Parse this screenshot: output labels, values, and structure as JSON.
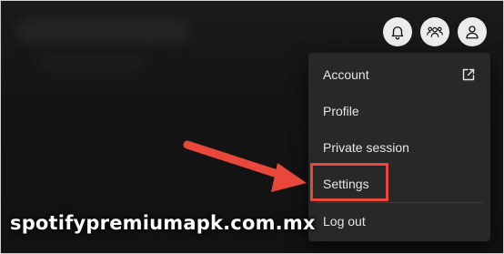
{
  "header": {
    "notifications_icon": "bell-icon",
    "friend_activity_icon": "friends-icon",
    "user_icon": "user-icon"
  },
  "menu": {
    "items": [
      {
        "label": "Account",
        "icon": "external-link-icon"
      },
      {
        "label": "Profile"
      },
      {
        "label": "Private session"
      },
      {
        "label": "Settings",
        "highlighted": true
      },
      {
        "label": "Log out"
      }
    ]
  },
  "annotation": {
    "arrow_color": "#e8473a",
    "highlight_color": "#e8473a"
  },
  "watermark": "spotifypremiumapk.com.mx"
}
